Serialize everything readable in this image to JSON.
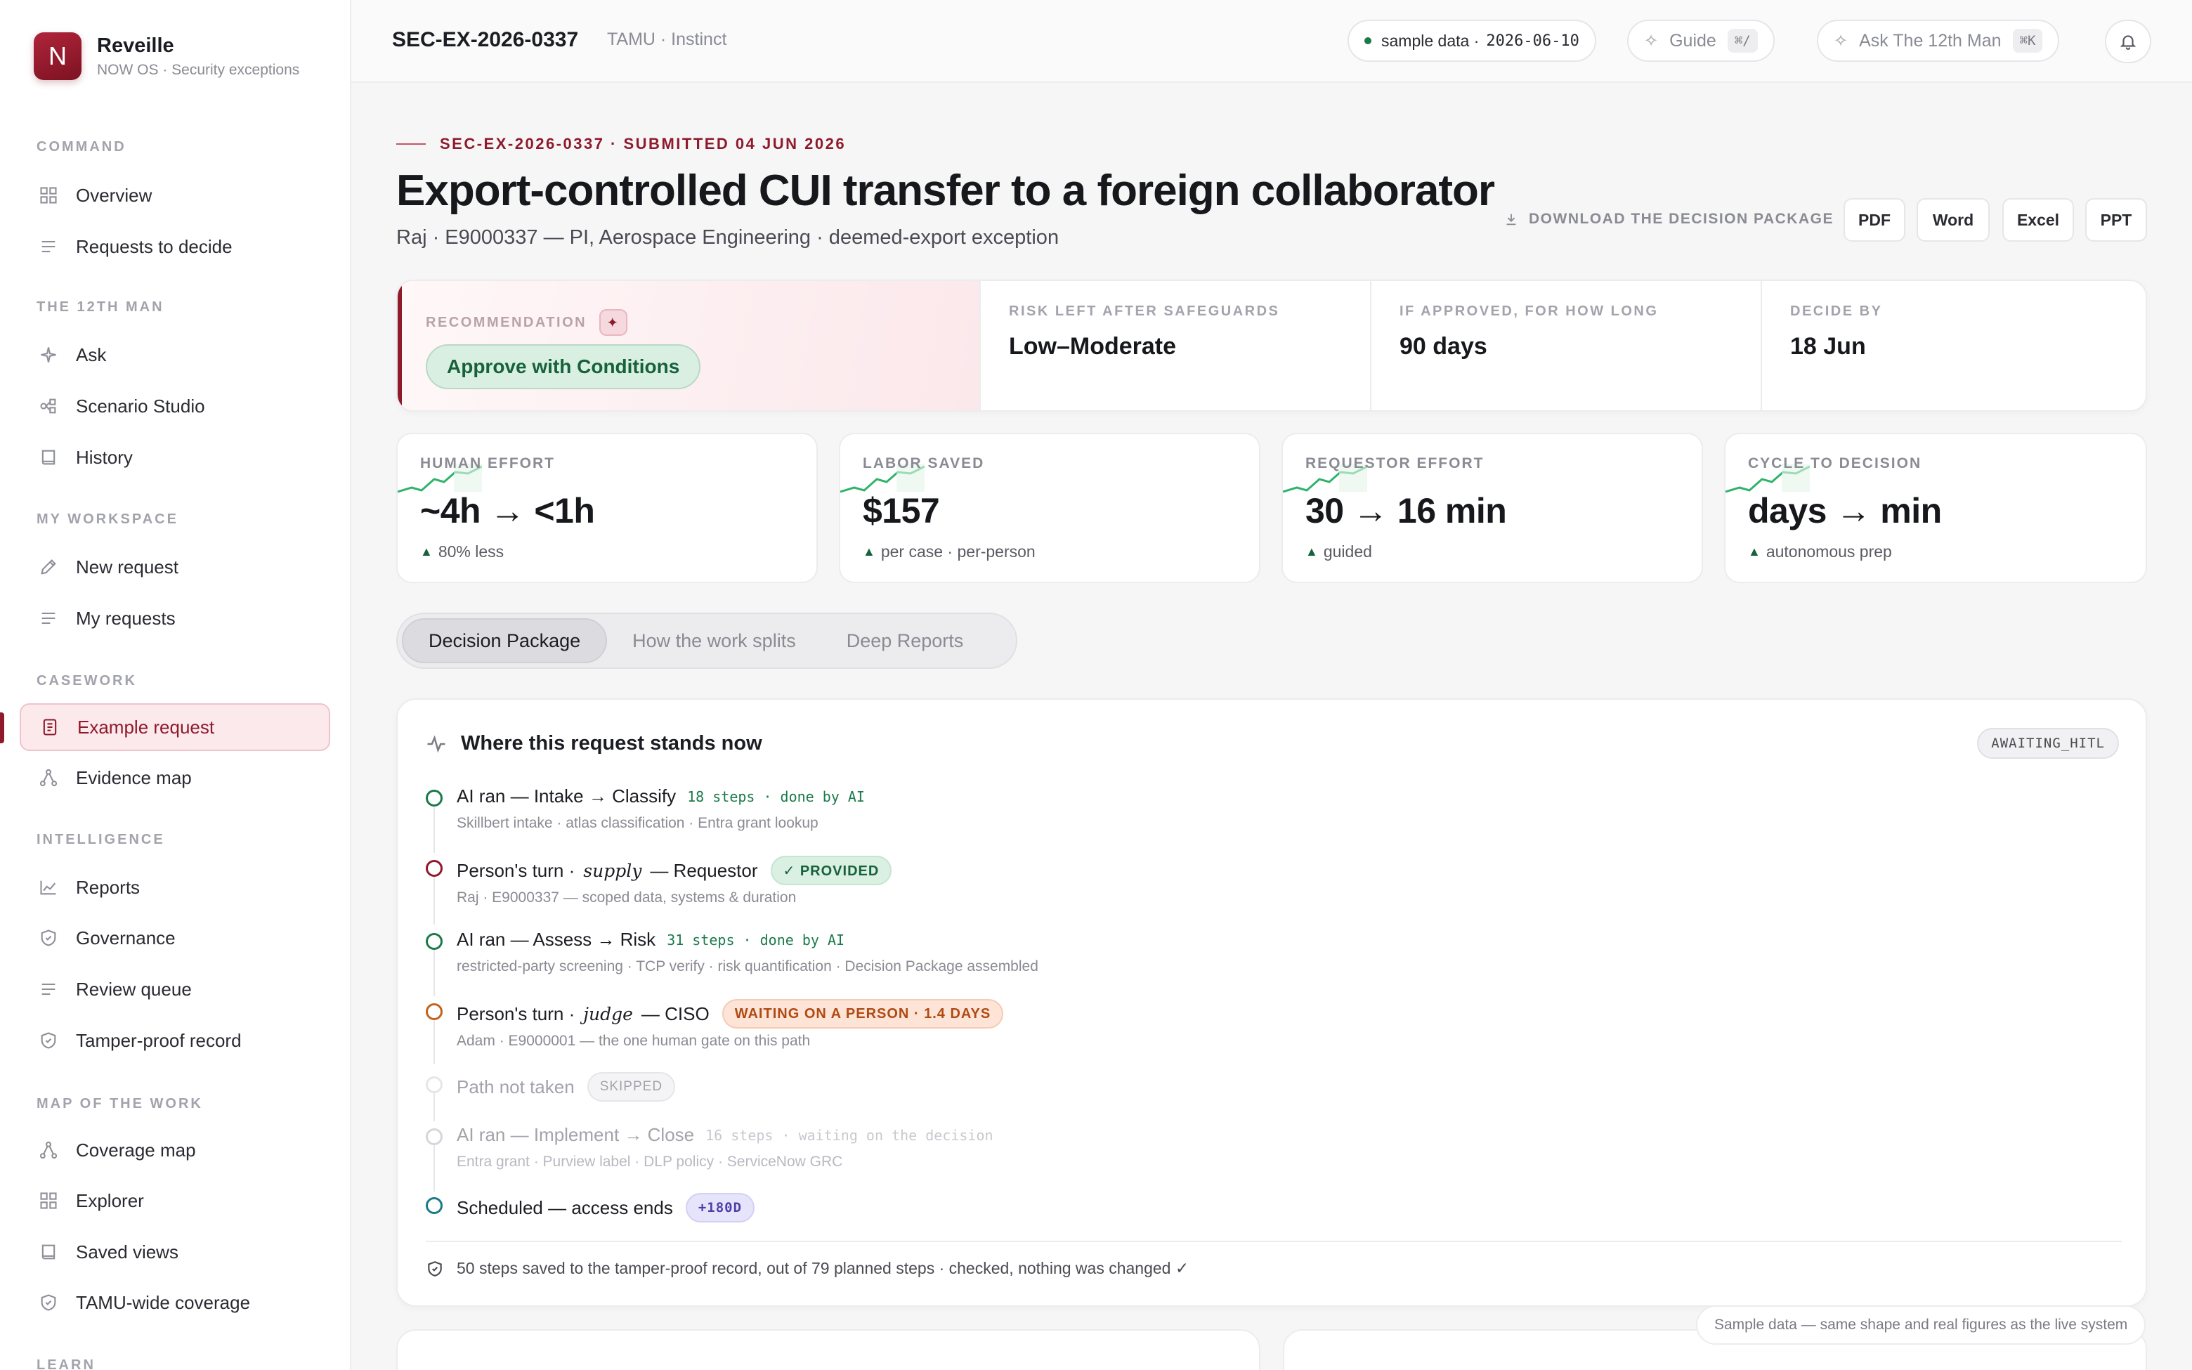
{
  "brand": {
    "initial": "N",
    "name": "Reveille",
    "subtitle": "NOW OS · Security exceptions"
  },
  "nav": {
    "sections": [
      {
        "label": "COMMAND",
        "items": [
          {
            "label": "Overview",
            "icon": "grid-icon"
          },
          {
            "label": "Requests to decide",
            "icon": "list-icon"
          }
        ]
      },
      {
        "label": "THE 12TH MAN",
        "items": [
          {
            "label": "Ask",
            "icon": "sparkle-icon"
          },
          {
            "label": "Scenario Studio",
            "icon": "nodes-icon"
          },
          {
            "label": "History",
            "icon": "book-icon"
          }
        ]
      },
      {
        "label": "MY WORKSPACE",
        "items": [
          {
            "label": "New request",
            "icon": "pencil-icon"
          },
          {
            "label": "My requests",
            "icon": "list-icon"
          }
        ]
      },
      {
        "label": "CASEWORK",
        "items": [
          {
            "label": "Example request",
            "icon": "document-icon",
            "active": true
          },
          {
            "label": "Evidence map",
            "icon": "graph-icon"
          }
        ]
      },
      {
        "label": "INTELLIGENCE",
        "items": [
          {
            "label": "Reports",
            "icon": "chart-icon"
          },
          {
            "label": "Governance",
            "icon": "shield-icon"
          },
          {
            "label": "Review queue",
            "icon": "list-icon"
          },
          {
            "label": "Tamper-proof record",
            "icon": "shield-icon"
          }
        ]
      },
      {
        "label": "MAP OF THE WORK",
        "items": [
          {
            "label": "Coverage map",
            "icon": "graph-icon"
          },
          {
            "label": "Explorer",
            "icon": "grid-icon"
          },
          {
            "label": "Saved views",
            "icon": "book-icon"
          },
          {
            "label": "TAMU-wide coverage",
            "icon": "shield-icon"
          }
        ]
      },
      {
        "label": "LEARN",
        "items": []
      }
    ]
  },
  "topbar": {
    "case_id": "SEC-EX-2026-0337",
    "org": "TAMU · Instinct",
    "sample_label": "sample data ·",
    "sample_date": "2026-06-10",
    "guide_label": "Guide",
    "guide_kbd": "⌘/",
    "ask_label": "Ask The 12th Man",
    "ask_kbd": "⌘K"
  },
  "header": {
    "eyebrow": "SEC-EX-2026-0337 · SUBMITTED 04 JUN 2026",
    "title": "Export-controlled CUI transfer to a foreign collaborator",
    "subtitle": "Raj · E9000337 — PI, Aerospace Engineering · deemed-export exception",
    "download_label": "DOWNLOAD THE DECISION PACKAGE",
    "downloads": [
      "PDF",
      "Word",
      "Excel",
      "PPT"
    ]
  },
  "recommendation": {
    "label": "RECOMMENDATION",
    "value": "Approve with Conditions",
    "cells": [
      {
        "label": "RISK LEFT AFTER SAFEGUARDS",
        "value": "Low–Moderate"
      },
      {
        "label": "IF APPROVED, FOR HOW LONG",
        "value": "90 days"
      },
      {
        "label": "DECIDE BY",
        "value": "18 Jun"
      }
    ]
  },
  "metrics": [
    {
      "label": "HUMAN EFFORT",
      "value": "~4h → <1h",
      "sub": "80% less"
    },
    {
      "label": "LABOR SAVED",
      "value": "$157",
      "sub": "per case · per-person"
    },
    {
      "label": "REQUESTOR EFFORT",
      "value": "30 → 16 min",
      "sub": "guided"
    },
    {
      "label": "CYCLE TO DECISION",
      "value": "days → min",
      "sub": "autonomous prep"
    }
  ],
  "tabs": [
    "Decision Package",
    "How the work splits",
    "Deep Reports"
  ],
  "status": {
    "heading": "Where this request stands now",
    "state": "AWAITING_HITL",
    "steps": [
      {
        "main": "AI ran — Intake → Classify",
        "meta": "18 steps · done by AI",
        "detail": "Skillbert intake · atlas classification · Entra grant lookup",
        "color": "#1a7a4a"
      },
      {
        "prefix": "Person's turn ·",
        "role": "supply",
        "suffix": "— Requestor",
        "tag": "✓ PROVIDED",
        "detail": "Raj · E9000337 — scoped data, systems & duration",
        "color": "#8e1a2c"
      },
      {
        "main": "AI ran — Assess → Risk",
        "meta": "31 steps · done by AI",
        "detail": "restricted-party screening · TCP verify · risk quantification · Decision Package assembled",
        "color": "#1a7a4a"
      },
      {
        "prefix": "Person's turn ·",
        "role": "judge",
        "suffix": "— CISO",
        "tag": "WAITING ON A PERSON · 1.4 DAYS",
        "detail": "Adam · E9000001 — the one human gate on this path",
        "color": "#c2621e"
      },
      {
        "main": "Path not taken",
        "tag": "SKIPPED",
        "color": "#e0e0e4"
      },
      {
        "main": "AI ran — Implement → Close",
        "meta": "16 steps · waiting on the decision",
        "detail": "Entra grant · Purview label · DLP policy · ServiceNow GRC",
        "color": "#d0d0d6"
      },
      {
        "main": "Scheduled — access ends",
        "tag": "+180D",
        "color": "#1a7a8a"
      }
    ],
    "footer": "50 steps saved to the tamper-proof record, out of 79 planned steps · checked, nothing was changed ✓"
  },
  "toast": "Sample data — same shape and real figures as the live system"
}
